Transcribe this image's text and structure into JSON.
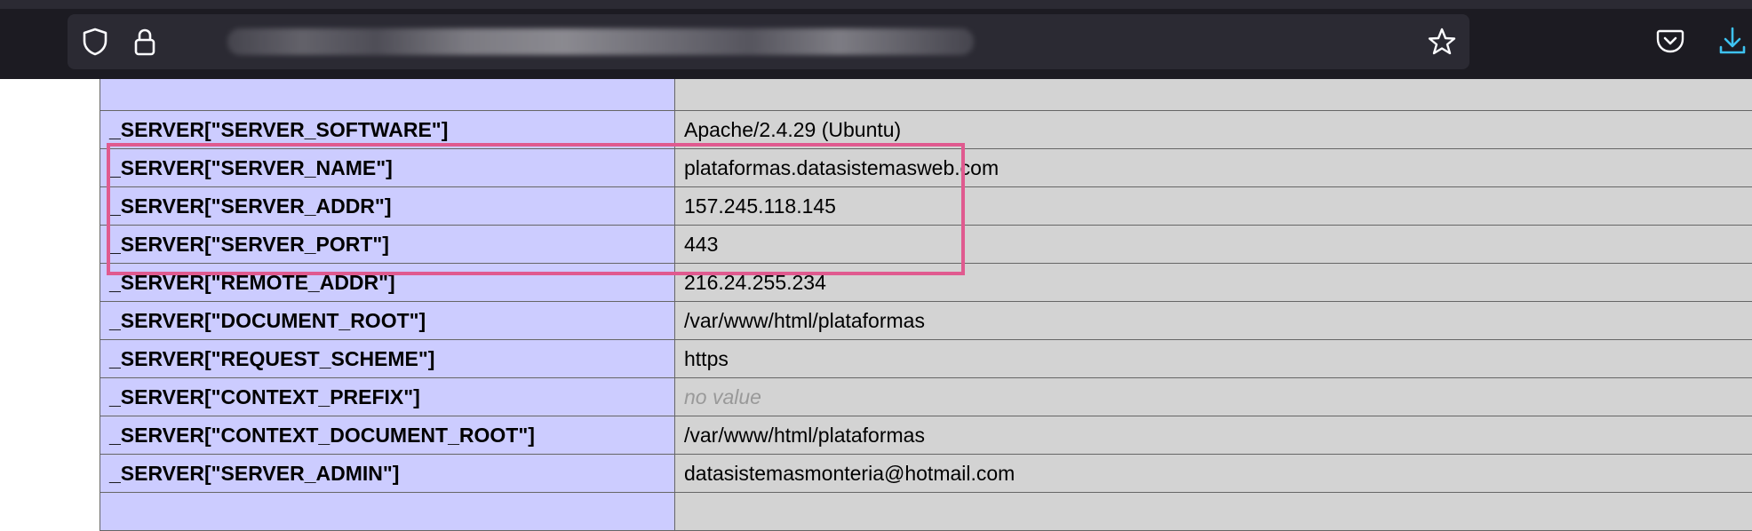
{
  "browser": {
    "url_blurred": true,
    "icons": {
      "shield": "shield-icon",
      "lock": "lock-icon",
      "bookmark": "star-icon",
      "pocket": "pocket-icon",
      "downloads": "download-icon"
    },
    "accent_color": "#3ec2f0"
  },
  "highlight_color": "#e05a8f",
  "table": {
    "rows": [
      {
        "key": "_SERVER[\"SERVER_SOFTWARE\"]",
        "value": "Apache/2.4.29 (Ubuntu)"
      },
      {
        "key": "_SERVER[\"SERVER_NAME\"]",
        "value": "plataformas.datasistemasweb.com"
      },
      {
        "key": "_SERVER[\"SERVER_ADDR\"]",
        "value": "157.245.118.145"
      },
      {
        "key": "_SERVER[\"SERVER_PORT\"]",
        "value": "443"
      },
      {
        "key": "_SERVER[\"REMOTE_ADDR\"]",
        "value": "216.24.255.234"
      },
      {
        "key": "_SERVER[\"DOCUMENT_ROOT\"]",
        "value": "/var/www/html/plataformas"
      },
      {
        "key": "_SERVER[\"REQUEST_SCHEME\"]",
        "value": "https"
      },
      {
        "key": "_SERVER[\"CONTEXT_PREFIX\"]",
        "value": "no value"
      },
      {
        "key": "_SERVER[\"CONTEXT_DOCUMENT_ROOT\"]",
        "value": "/var/www/html/plataformas"
      },
      {
        "key": "_SERVER[\"SERVER_ADMIN\"]",
        "value": "datasistemasmonteria@hotmail.com"
      }
    ]
  },
  "colors": {
    "key_cell": "#ccccff",
    "value_cell": "#d3d3d3",
    "no_value_text": "#999999"
  }
}
